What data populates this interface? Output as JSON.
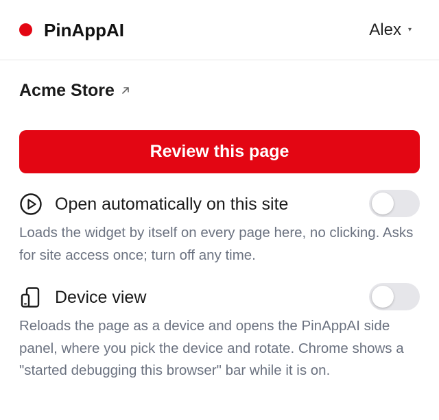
{
  "header": {
    "brand_name": "PinAppAI",
    "brand_color": "#e30613",
    "user_name": "Alex",
    "user_caret": "▾"
  },
  "site": {
    "name": "Acme Store",
    "link_icon": "external-arrow-icon"
  },
  "review_button": {
    "label": "Review this page",
    "color": "#e30613"
  },
  "options": [
    {
      "icon": "play-circle-icon",
      "label": "Open automatically on this site",
      "description": "Loads the widget by itself on every page here, no clicking. Asks for site access once; turn off any time.",
      "enabled": false
    },
    {
      "icon": "device-view-icon",
      "label": "Device view",
      "description": "Reloads the page as a device and opens the PinAppAI side panel, where you pick the device and rotate. Chrome shows a \"started debugging this browser\" bar while it is on.",
      "enabled": false
    }
  ]
}
